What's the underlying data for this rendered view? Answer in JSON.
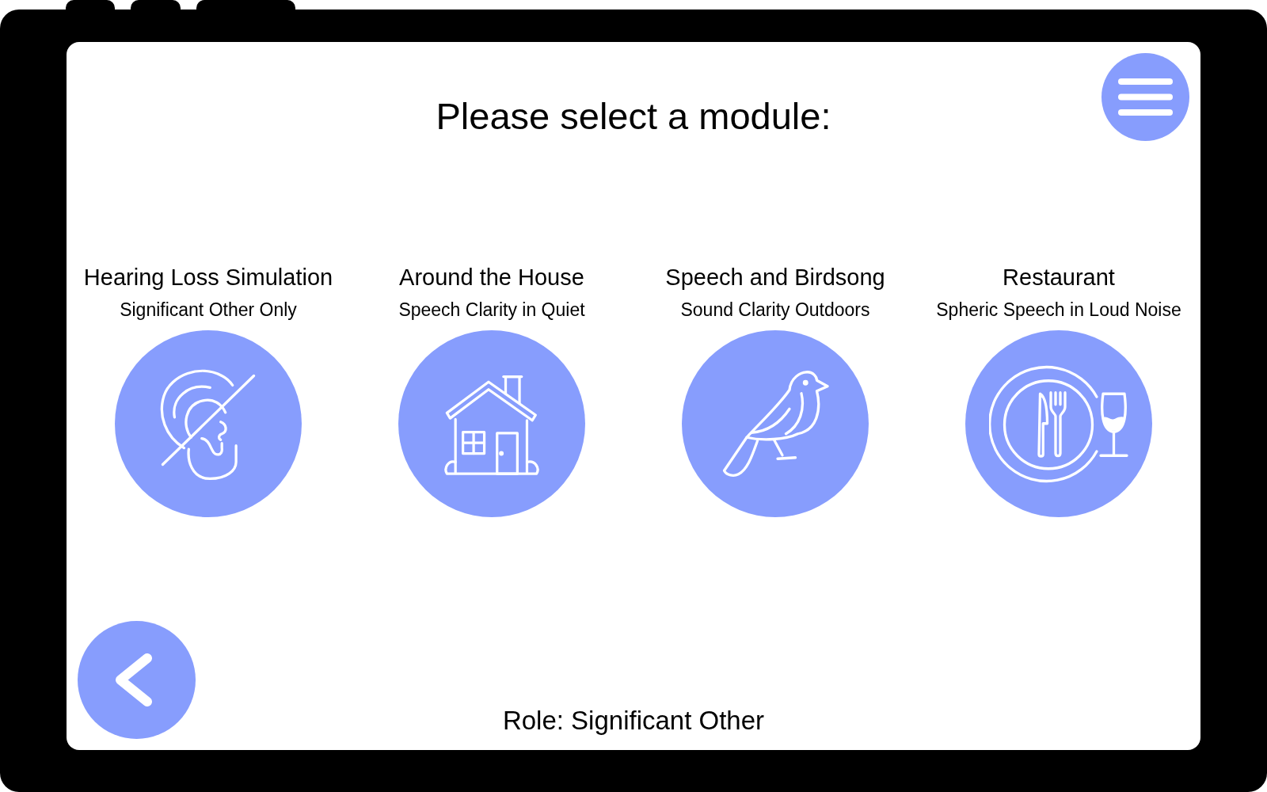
{
  "title": "Please select a module:",
  "modules": [
    {
      "kind": "hearing-loss",
      "title": "Hearing Loss Simulation",
      "subtitle": "Significant Other Only"
    },
    {
      "kind": "house",
      "title": "Around the House",
      "subtitle": "Speech Clarity in Quiet"
    },
    {
      "kind": "birdsong",
      "title": "Speech and Birdsong",
      "subtitle": "Sound Clarity Outdoors"
    },
    {
      "kind": "restaurant",
      "title": "Restaurant",
      "subtitle": "Spheric Speech in Loud Noise"
    }
  ],
  "footer": {
    "role": "Role: Significant Other"
  }
}
